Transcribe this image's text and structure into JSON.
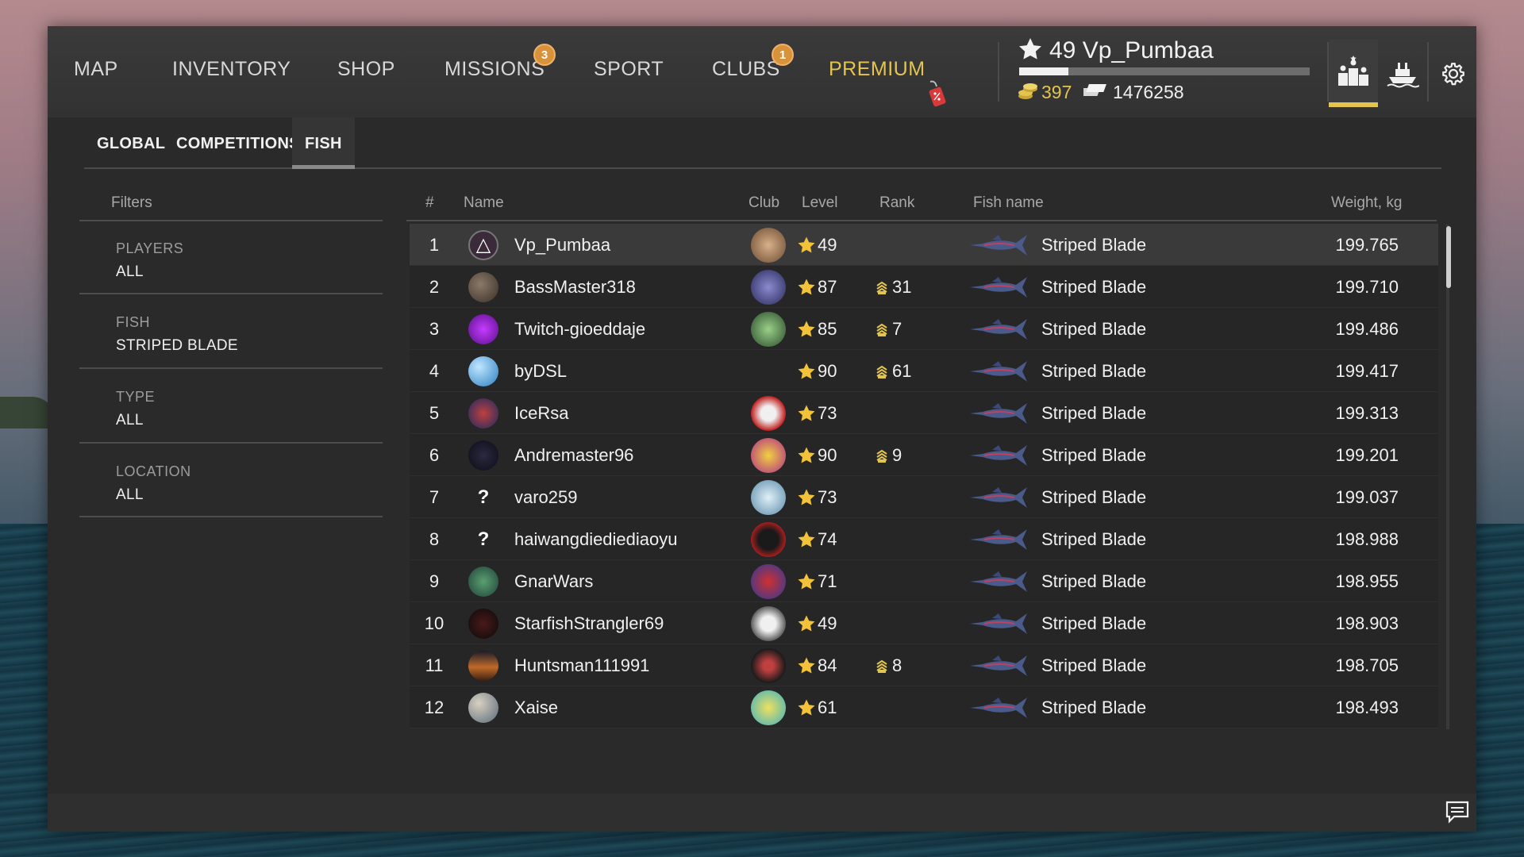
{
  "nav": {
    "items": [
      {
        "label": "MAP"
      },
      {
        "label": "INVENTORY"
      },
      {
        "label": "SHOP"
      },
      {
        "label": "MISSIONS",
        "badge": "3"
      },
      {
        "label": "SPORT"
      },
      {
        "label": "CLUBS",
        "badge": "1"
      },
      {
        "label": "PREMIUM"
      }
    ]
  },
  "profile": {
    "name": "49 Vp_Pumbaa",
    "gold": "397",
    "silver": "1476258",
    "xp_fraction": 0.17
  },
  "subtabs": [
    "GLOBAL",
    "COMPETITIONS",
    "FISH"
  ],
  "filters": {
    "title": "Filters",
    "items": [
      {
        "label": "PLAYERS",
        "value": "ALL"
      },
      {
        "label": "FISH",
        "value": "STRIPED BLADE"
      },
      {
        "label": "TYPE",
        "value": "ALL"
      },
      {
        "label": "LOCATION",
        "value": "ALL"
      }
    ]
  },
  "table": {
    "headers": {
      "rank": "#",
      "name": "Name",
      "club": "Club",
      "level": "Level",
      "rank_col": "Rank",
      "fish": "Fish name",
      "weight": "Weight, kg"
    },
    "rows": [
      {
        "rank": "1",
        "name": "Vp_Pumbaa",
        "level": "49",
        "rank_val": "",
        "fish": "Striped Blade",
        "weight": "199.765"
      },
      {
        "rank": "2",
        "name": "BassMaster318",
        "level": "87",
        "rank_val": "31",
        "fish": "Striped Blade",
        "weight": "199.710"
      },
      {
        "rank": "3",
        "name": "Twitch-gioeddaje",
        "level": "85",
        "rank_val": "7",
        "fish": "Striped Blade",
        "weight": "199.486"
      },
      {
        "rank": "4",
        "name": "byDSL",
        "level": "90",
        "rank_val": "61",
        "fish": "Striped Blade",
        "weight": "199.417"
      },
      {
        "rank": "5",
        "name": "IceRsa",
        "level": "73",
        "rank_val": "",
        "fish": "Striped Blade",
        "weight": "199.313"
      },
      {
        "rank": "6",
        "name": "Andremaster96",
        "level": "90",
        "rank_val": "9",
        "fish": "Striped Blade",
        "weight": "199.201"
      },
      {
        "rank": "7",
        "name": "varo259",
        "level": "73",
        "rank_val": "",
        "fish": "Striped Blade",
        "weight": "199.037"
      },
      {
        "rank": "8",
        "name": "haiwangdiediediaoyu",
        "level": "74",
        "rank_val": "",
        "fish": "Striped Blade",
        "weight": "198.988"
      },
      {
        "rank": "9",
        "name": "GnarWars",
        "level": "71",
        "rank_val": "",
        "fish": "Striped Blade",
        "weight": "198.955"
      },
      {
        "rank": "10",
        "name": "StarfishStrangler69",
        "level": "49",
        "rank_val": "",
        "fish": "Striped Blade",
        "weight": "198.903"
      },
      {
        "rank": "11",
        "name": "Huntsman111991",
        "level": "84",
        "rank_val": "8",
        "fish": "Striped Blade",
        "weight": "198.705"
      },
      {
        "rank": "12",
        "name": "Xaise",
        "level": "61",
        "rank_val": "",
        "fish": "Striped Blade",
        "weight": "198.493"
      }
    ]
  },
  "colors": {
    "accent": "#e3c44f",
    "panel": "#2a2a2a",
    "highlight_row": "#3a3a3a"
  }
}
